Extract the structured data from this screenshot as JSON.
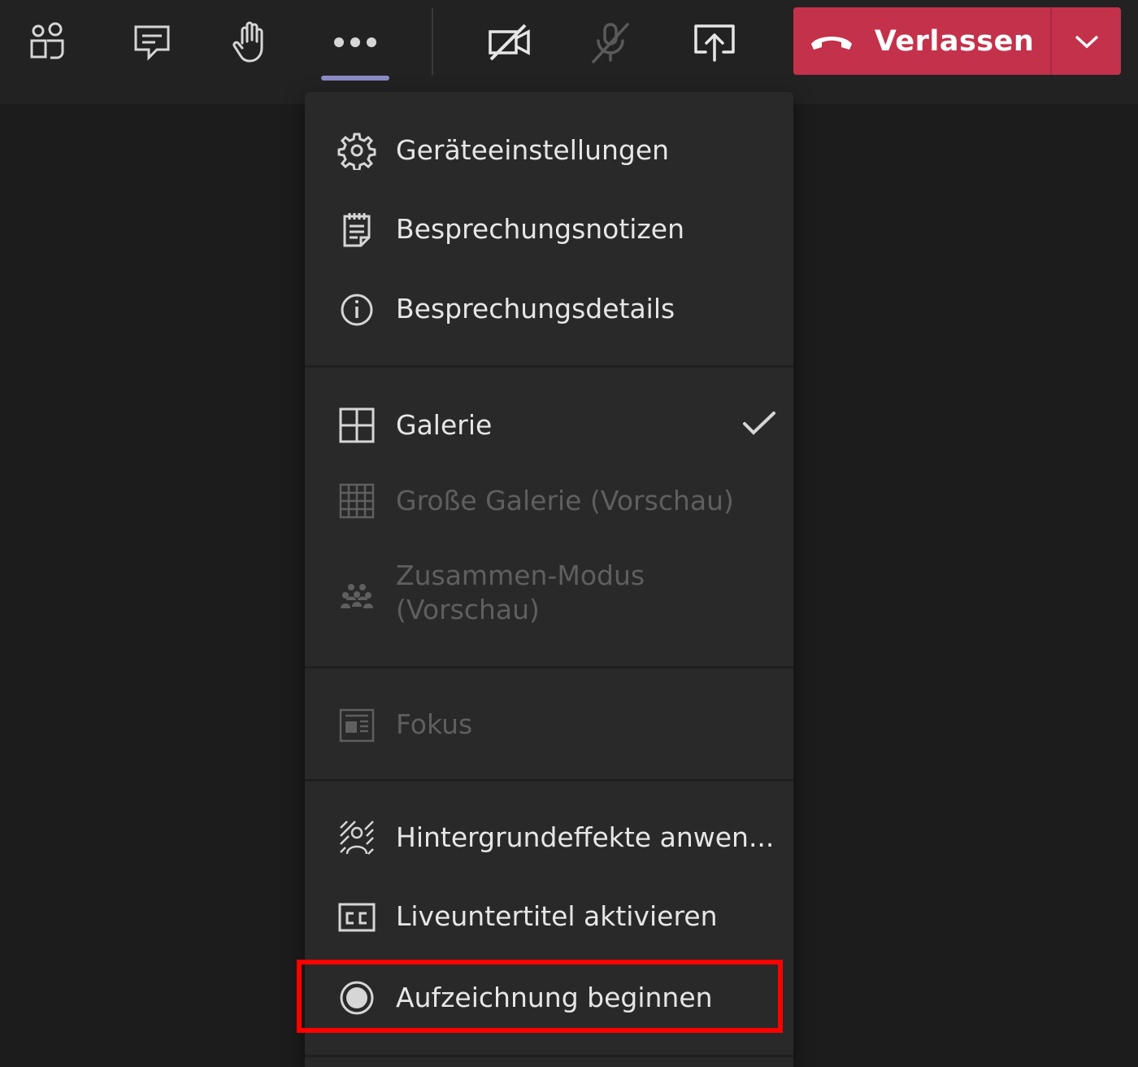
{
  "toolbar": {
    "participants_icon": "people-icon",
    "chat_icon": "chat-icon",
    "raise_hand_icon": "raise-hand-icon",
    "more_icon": "more-dots-icon",
    "camera_icon": "camera-off-icon",
    "mic_icon": "mic-off-icon",
    "share_icon": "share-screen-icon",
    "leave_label": "Verlassen",
    "leave_icon": "hang-up-icon",
    "leave_options_icon": "chevron-down-icon"
  },
  "colors": {
    "leave_red": "#c4314b",
    "accent_purple": "#8b8cc7",
    "highlight_red": "#ff0000"
  },
  "menu": {
    "group1": [
      {
        "label": "Geräteeinstellungen",
        "icon": "gear-icon"
      },
      {
        "label": "Besprechungsnotizen",
        "icon": "notes-icon"
      },
      {
        "label": "Besprechungsdetails",
        "icon": "info-icon"
      }
    ],
    "group2": [
      {
        "label": "Galerie",
        "icon": "grid-icon",
        "checked": true
      },
      {
        "label": "Große Galerie (Vorschau)",
        "icon": "large-grid-icon",
        "disabled": true
      },
      {
        "label_line1": "Zusammen-Modus",
        "label_line2": "(Vorschau)",
        "icon": "together-mode-icon",
        "disabled": true
      }
    ],
    "group3": [
      {
        "label": "Fokus",
        "icon": "focus-icon",
        "disabled": true
      }
    ],
    "group4": [
      {
        "label": "Hintergrundeffekte anwen...",
        "icon": "background-effects-icon"
      },
      {
        "label": "Liveuntertitel aktivieren",
        "icon": "captions-icon"
      },
      {
        "label": "Aufzeichnung beginnen",
        "icon": "record-icon",
        "highlighted": true
      }
    ]
  }
}
